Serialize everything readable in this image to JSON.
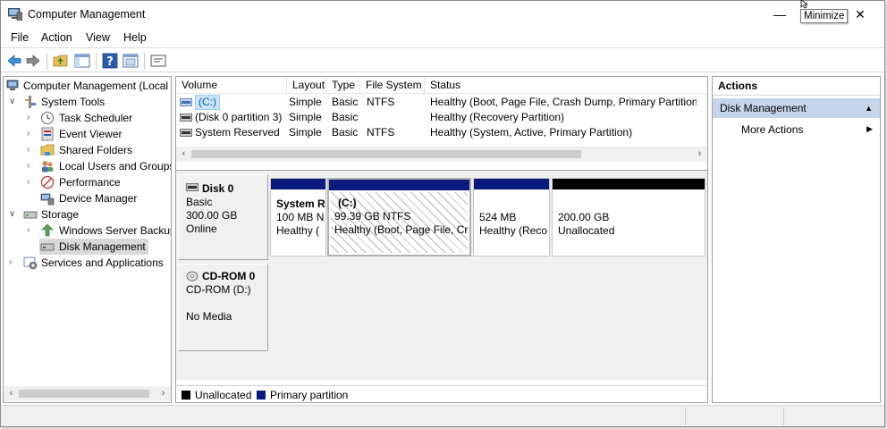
{
  "window": {
    "title": "Computer Management",
    "minimize_glyph": "—",
    "close_glyph": "✕",
    "tooltip": "Minimize"
  },
  "menu": [
    "File",
    "Action",
    "View",
    "Help"
  ],
  "toolbar_icons": [
    "back-icon",
    "forward-icon",
    "up-folder-icon",
    "show-hide-tree-icon",
    "help-icon",
    "properties-icon",
    "console-icon"
  ],
  "tree": {
    "root": "Computer Management (Local",
    "system_tools": "System Tools",
    "task_scheduler": "Task Scheduler",
    "event_viewer": "Event Viewer",
    "shared_folders": "Shared Folders",
    "local_users": "Local Users and Groups",
    "performance": "Performance",
    "device_manager": "Device Manager",
    "storage": "Storage",
    "windows_server_backup": "Windows Server Backup",
    "disk_management": "Disk Management",
    "services_apps": "Services and Applications"
  },
  "volume_table": {
    "columns": [
      "Volume",
      "Layout",
      "Type",
      "File System",
      "Status"
    ],
    "rows": [
      {
        "volume": "(C:)",
        "layout": "Simple",
        "type": "Basic",
        "fs": "NTFS",
        "status": "Healthy (Boot, Page File, Crash Dump, Primary Partition)"
      },
      {
        "volume": "(Disk 0 partition 3)",
        "layout": "Simple",
        "type": "Basic",
        "fs": "",
        "status": "Healthy (Recovery Partition)"
      },
      {
        "volume": "System Reserved",
        "layout": "Simple",
        "type": "Basic",
        "fs": "NTFS",
        "status": "Healthy (System, Active, Primary Partition)"
      }
    ]
  },
  "disks": {
    "disk0": {
      "name": "Disk 0",
      "type": "Basic",
      "size": "300.00 GB",
      "state": "Online",
      "partitions": [
        {
          "title": "System R",
          "line1": "100 MB N",
          "line2": "Healthy (",
          "bar": "#0a1a7e"
        },
        {
          "title": "(C:)",
          "line1": "99.39 GB NTFS",
          "line2": "Healthy (Boot, Page File, Cr",
          "bar": "#0a1a7e"
        },
        {
          "title": "",
          "line1": "524 MB",
          "line2": "Healthy (Reco",
          "bar": "#0a1a7e"
        },
        {
          "title": "",
          "line1": "200.00 GB",
          "line2": "Unallocated",
          "bar": "#000000"
        }
      ]
    },
    "cdrom0": {
      "name": "CD-ROM 0",
      "type": "CD-ROM (D:)",
      "state": "No Media"
    }
  },
  "legend": {
    "unallocated": "Unallocated",
    "primary": "Primary partition",
    "unallocated_color": "#000000",
    "primary_color": "#0a1a7e"
  },
  "actions": {
    "header": "Actions",
    "section": "Disk Management",
    "section_arrow": "▲",
    "item": "More Actions",
    "item_arrow": "▶"
  }
}
